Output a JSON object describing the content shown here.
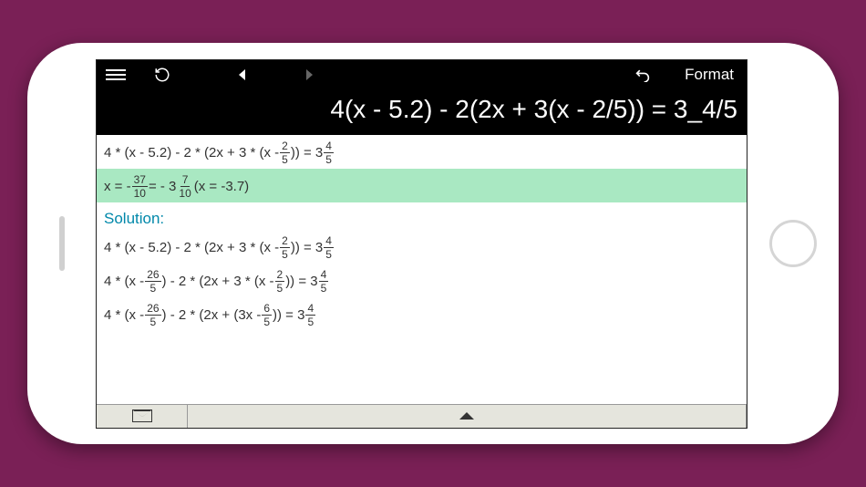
{
  "toolbar": {
    "format_label": "Format"
  },
  "input": {
    "equation": "4(x - 5.2) - 2(2x + 3(x - 2/5)) = 3_4/5"
  },
  "content": {
    "line1": {
      "prefix": "4 * (x - 5.2) - 2 * (2x + 3 * (x - ",
      "frac1_num": "2",
      "frac1_den": "5",
      "mid": ")) = 3",
      "frac2_num": "4",
      "frac2_den": "5"
    },
    "answer": {
      "p1": "x = - ",
      "f1n": "37",
      "f1d": "10",
      "p2": " = - 3",
      "f2n": "7",
      "f2d": "10",
      "p3": " (x = -3.7)"
    },
    "solution_label": "Solution:",
    "steps": [
      {
        "a": "4 * (x - 5.2) - 2 * (2x + 3 * (x - ",
        "f1n": "2",
        "f1d": "5",
        "b": ")) = 3",
        "f2n": "4",
        "f2d": "5"
      },
      {
        "a": "4 * (x - ",
        "f0n": "26",
        "f0d": "5",
        "a2": ") - 2 * (2x + 3 * (x - ",
        "f1n": "2",
        "f1d": "5",
        "b": ")) = 3",
        "f2n": "4",
        "f2d": "5"
      },
      {
        "a": "4 * (x - ",
        "f0n": "26",
        "f0d": "5",
        "a2": ") - 2 * (2x + (3x - ",
        "f1n": "6",
        "f1d": "5",
        "b": ")) = 3",
        "f2n": "4",
        "f2d": "5"
      }
    ]
  }
}
